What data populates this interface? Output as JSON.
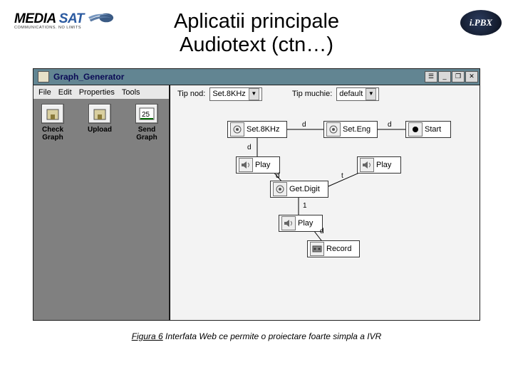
{
  "logo_left": {
    "word1": "MEDIA ",
    "word2": "SAT",
    "tagline": "COMMUNICATIONS. NO LIMITS"
  },
  "logo_right": "i.PBX",
  "title_line1": "Aplicatii principale",
  "title_line2": "Audiotext (ctn…)",
  "window_title": "Graph_Generator",
  "titlebar_buttons": {
    "ext": "☰",
    "min": "_",
    "max": "❐",
    "close": "✕"
  },
  "menu": {
    "file": "File",
    "edit": "Edit",
    "properties": "Properties",
    "tools": "Tools"
  },
  "toolbar": {
    "check": "Check Graph",
    "upload": "Upload",
    "send": "Send Graph"
  },
  "canvas_header": {
    "tip_nod_label": "Tip nod:",
    "tip_nod_value": "Set.8KHz",
    "tip_muchie_label": "Tip muchie:",
    "tip_muchie_value": "default"
  },
  "nodes": {
    "set8khz": "Set.8KHz",
    "seteng": "Set.Eng",
    "start": "Start",
    "play1": "Play",
    "play2": "Play",
    "getdigit": "Get.Digit",
    "play3": "Play",
    "record": "Record"
  },
  "edge_labels": {
    "d1": "d",
    "d2": "d",
    "d3": "d",
    "one": "1",
    "d4": "d",
    "t": "t"
  },
  "caption": {
    "figure": "Figura 6",
    "text": " Interfata Web ce permite o proiectare foarte simpla a IVR"
  }
}
